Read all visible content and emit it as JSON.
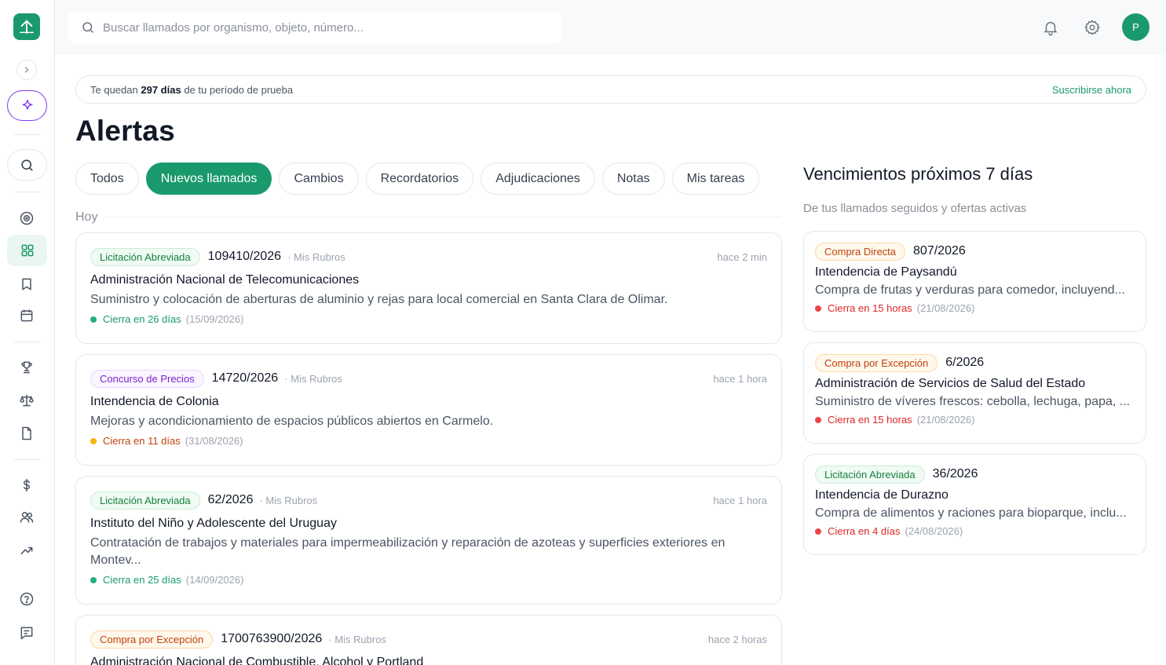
{
  "search": {
    "placeholder": "Buscar llamados por organismo, objeto, número..."
  },
  "user": {
    "initial": "P"
  },
  "trial": {
    "prefix": "Te quedan",
    "days": "297 días",
    "suffix": "de tu período de prueba",
    "cta": "Suscribirse ahora"
  },
  "page": {
    "title": "Alertas"
  },
  "tabs": [
    {
      "label": "Todos",
      "active": false
    },
    {
      "label": "Nuevos llamados",
      "active": true
    },
    {
      "label": "Cambios",
      "active": false
    },
    {
      "label": "Recordatorios",
      "active": false
    },
    {
      "label": "Adjudicaciones",
      "active": false
    },
    {
      "label": "Notas",
      "active": false
    },
    {
      "label": "Mis tareas",
      "active": false
    }
  ],
  "group": {
    "label": "Hoy"
  },
  "alerts": [
    {
      "type": "Licitación Abreviada",
      "number": "109410/2026",
      "rubro": "· Mis Rubros",
      "time": "hace 2 min",
      "org": "Administración Nacional de Telecomunicaciones",
      "desc": "Suministro y colocación de aberturas de aluminio y rejas para local comercial en Santa Clara de Olimar.",
      "closes": "Cierra en 26 días",
      "date": "(15/09/2026)"
    },
    {
      "type": "Concurso de Precios",
      "number": "14720/2026",
      "rubro": "· Mis Rubros",
      "time": "hace 1 hora",
      "org": "Intendencia de Colonia",
      "desc": "Mejoras y acondicionamiento de espacios públicos abiertos en Carmelo.",
      "closes": "Cierra en 11 días",
      "date": "(31/08/2026)"
    },
    {
      "type": "Licitación Abreviada",
      "number": "62/2026",
      "rubro": "· Mis Rubros",
      "time": "hace 1 hora",
      "org": "Instituto del Niño y Adolescente del Uruguay",
      "desc": "Contratación de trabajos y materiales para impermeabilización y reparación de azoteas y superficies exteriores en Montev...",
      "closes": "Cierra en 25 días",
      "date": "(14/09/2026)"
    },
    {
      "type": "Compra por Excepción",
      "number": "1700763900/2026",
      "rubro": "· Mis Rubros",
      "time": "hace 2 horas",
      "org": "Administración Nacional de Combustible, Alcohol y Portland",
      "desc": "",
      "closes": "",
      "date": ""
    }
  ],
  "upcoming": {
    "title": "Vencimientos próximos 7 días",
    "subtitle": "De tus llamados seguidos y ofertas activas",
    "items": [
      {
        "type": "Compra Directa",
        "number": "807/2026",
        "org": "Intendencia de Paysandú",
        "desc": "Compra de frutas y verduras para comedor, incluyend...",
        "closes": "Cierra en 15 horas",
        "date": "(21/08/2026)"
      },
      {
        "type": "Compra por Excepción",
        "number": "6/2026",
        "org": "Administración de Servicios de Salud del Estado",
        "desc": "Suministro de víveres frescos: cebolla, lechuga, papa, ...",
        "closes": "Cierra en 15 horas",
        "date": "(21/08/2026)"
      },
      {
        "type": "Licitación Abreviada",
        "number": "36/2026",
        "org": "Intendencia de Durazno",
        "desc": "Compra de alimentos y raciones para bioparque, inclu...",
        "closes": "Cierra en 4 días",
        "date": "(24/08/2026)"
      }
    ]
  },
  "colors": {
    "brand": "#1a9a6c",
    "ai_accent": "#7c3aed",
    "urgent": "#dc2626",
    "warning": "#f5b40a"
  },
  "icons": [
    "logo-icon",
    "chevron-right-icon",
    "sparkle-icon",
    "search-icon",
    "target-icon",
    "grid-icon",
    "bookmark-icon",
    "calendar-icon",
    "trophy-icon",
    "scale-icon",
    "file-icon",
    "dollar-icon",
    "users-icon",
    "trending-up-icon",
    "help-icon",
    "message-icon",
    "bell-icon",
    "gear-icon"
  ]
}
